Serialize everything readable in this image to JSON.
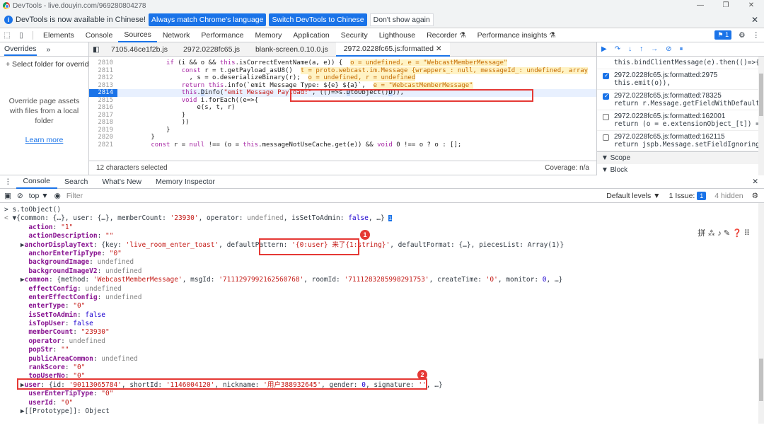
{
  "window": {
    "title": "DevTools - live.douyin.com/969280804278",
    "controls": [
      "—",
      "❐",
      "✕"
    ]
  },
  "infobar": {
    "message": "DevTools is now available in Chinese!",
    "btn_match": "Always match Chrome's language",
    "btn_switch": "Switch DevTools to Chinese",
    "btn_dont": "Don't show again"
  },
  "main_tabs": [
    "Elements",
    "Console",
    "Sources",
    "Network",
    "Performance",
    "Memory",
    "Application",
    "Security",
    "Lighthouse",
    "Recorder ⚗",
    "Performance insights ⚗"
  ],
  "issues_count": "1",
  "navigator": {
    "tab": "Overrides",
    "select_folder": "+ Select folder for overrides",
    "description": "Override page assets with files from a local folder",
    "learn_more": "Learn more"
  },
  "file_tabs": [
    "7105.46ce1f2b.js",
    "2972.0228fc65.js",
    "blank-screen.0.10.0.js",
    "2972.0228fc65.js:formatted"
  ],
  "code_lines": [
    {
      "n": "2810",
      "html": "            <span class='kw'>if</span> (i && o && <span class='kw'>this</span>.isCorrectEventName(a, e)) {  <span class='hint'>o = undefined, e = \"WebcastMemberMessage\"</span>"
    },
    {
      "n": "2811",
      "html": "                <span class='kw'>const</span> r = t.getPayload_asU8()  <span class='hint'>t = proto.webcast.im.Message {wrappers_: null, messageId_: undefined, array</span>"
    },
    {
      "n": "2812",
      "html": "                  , s = o.deserializeBinary(r);  <span class='hint'>o = undefined, r = undefined</span>"
    },
    {
      "n": "2813",
      "html": "                <span class='kw'>return</span> <span class='kw'>this</span>.info(`emit Message Type: ${e} ${a}`,  <span class='hint'>e = \"WebcastMemberMessage\"</span>"
    },
    {
      "n": "2814",
      "html": "                <span class='kw'>this</span>.<span style='background:#c6dafc'>D</span>info(<span class='str'>\"emit Message Payload:\"</span>, (()=>s.<span style='background:#c6dafc'>D</span>toObject()<span style='background:#c6dafc'>D</span>)),",
      "exec": true
    },
    {
      "n": "2815",
      "html": "                <span class='kw'>void</span> i.forEach((e=>{"
    },
    {
      "n": "2816",
      "html": "                    e(s, t, r)"
    },
    {
      "n": "2817",
      "html": "                }"
    },
    {
      "n": "2818",
      "html": "                ))"
    },
    {
      "n": "2819",
      "html": "            }"
    },
    {
      "n": "2820",
      "html": "        }"
    },
    {
      "n": "2821",
      "html": "        <span class='kw'>const</span> r = <span class='kw'>null</span> !== (o = <span class='kw'>this</span>.messageNotUseCache.get(e)) && <span class='kw'>void</span> 0 !== o ? o : [];"
    }
  ],
  "editor_footer": {
    "selected": "12 characters selected",
    "coverage": "Coverage: n/a"
  },
  "debugger": {
    "top_line": "this.bindClientMessage(e).then(()=>{",
    "breakpoints": [
      {
        "file": "2972.0228fc65.js:formatted:2975",
        "code": "this.emit(o)),",
        "checked": true
      },
      {
        "file": "2972.0228fc65.js:formatted:78325",
        "code": "return r.Message.getFieldWithDefault…",
        "checked": true
      },
      {
        "file": "2972.0228fc65.js:formatted:162001",
        "code": "return (o = e.extensionObject_[t]) =…",
        "checked": false
      },
      {
        "file": "2972.0228fc65.js:formatted:162115",
        "code": "return jspb.Message.setFieldIgnoring…",
        "checked": false
      }
    ],
    "scope": "▼ Scope",
    "block": "▼ Block"
  },
  "drawer_tabs": [
    "Console",
    "Search",
    "What's New",
    "Memory Inspector"
  ],
  "console_toolbar": {
    "context": "top ▼",
    "filter": "Filter",
    "levels": "Default levels ▼",
    "issue": "1 Issue:",
    "issue_count": "1",
    "hidden": "4 hidden"
  },
  "console_lines": [
    "<span>&gt; s.toObject()</span>",
    "<span class='u'>&lt;</span> ▼{common: {…}, user: {…}, memberCount: <span class='s'>'23930'</span>, operator: <span class='u'>undefined</span>, isSetToAdmin: <span class='b'>false</span>, …} <span style='background:#1a73e8;color:#fff;font-size:8px'>i</span>",
    "      <span class='k'>action</span>: <span class='s'>\"1\"</span>",
    "      <span class='k'>actionDescription</span>: <span class='s'>\"\"</span>",
    "    ▶<span class='k'>anchorDisplayText</span>: {key: <span class='s'>'live_room_enter_toast'</span>, defaultPattern: <span class='s'>'{0:user} 来了{1:string}'</span>, defaultFormat: {…}, piecesList: Array(1)}",
    "      <span class='k'>anchorEnterTipType</span>: <span class='s'>\"0\"</span>",
    "      <span class='k'>backgroundImage</span>: <span class='u'>undefined</span>",
    "      <span class='k'>backgroundImageV2</span>: <span class='u'>undefined</span>",
    "    ▶<span class='k'>common</span>: {method: <span class='s'>'WebcastMemberMessage'</span>, msgId: <span class='s'>'7111297992162560768'</span>, roomId: <span class='s'>'7111283285998291753'</span>, createTime: <span class='s'>'0'</span>, monitor: <span class='n'>0</span>, …}",
    "      <span class='k'>effectConfig</span>: <span class='u'>undefined</span>",
    "      <span class='k'>enterEffectConfig</span>: <span class='u'>undefined</span>",
    "      <span class='k'>enterType</span>: <span class='s'>\"0\"</span>",
    "      <span class='k'>isSetToAdmin</span>: <span class='b'>false</span>",
    "      <span class='k'>isTopUser</span>: <span class='b'>false</span>",
    "      <span class='k'>memberCount</span>: <span class='s'>\"23930\"</span>",
    "      <span class='k'>operator</span>: <span class='u'>undefined</span>",
    "      <span class='k'>popStr</span>: <span class='s'>\"\"</span>",
    "      <span class='k'>publicAreaCommon</span>: <span class='u'>undefined</span>",
    "      <span class='k'>rankScore</span>: <span class='s'>\"0\"</span>",
    "      <span class='k'>topUserNo</span>: <span class='s'>\"0\"</span>",
    "    ▶<span class='k'>user</span>: {id: <span class='s'>'90113065784'</span>, shortId: <span class='s'>'1146004120'</span>, nickname: <span class='s'>'用户388932645'</span>, gender: <span class='n'>0</span>, signature: <span class='s'>''</span>, …}",
    "      <span class='k'>userEnterTipType</span>: <span class='s'>\"0\"</span>",
    "      <span class='k'>userId</span>: <span class='s'>\"0\"</span>",
    "    ▶[[Prototype]]: Object"
  ],
  "annotations": {
    "marker1": "1",
    "marker2": "2"
  },
  "ime_icons": "拼 ⁂ ♪ ✎ ❓ ⠿",
  "colors": {
    "accent": "#1a73e8",
    "highlight_box": "#e53935"
  }
}
